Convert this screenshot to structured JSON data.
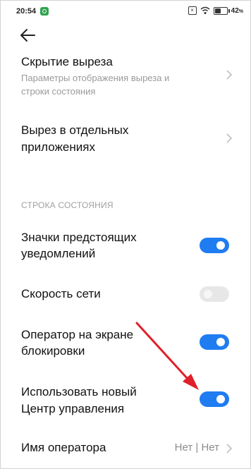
{
  "status_bar": {
    "time": "20:54",
    "battery_pct": "42",
    "percent_sign": "%"
  },
  "back_icon": "arrow-left-icon",
  "items": {
    "cutout_hide": {
      "title": "Скрытие выреза",
      "subtitle_line1": "Параметры отображения выреза и",
      "subtitle_line2": "строки состояния"
    },
    "cutout_apps": {
      "title_line1": "Вырез в отдельных",
      "title_line2": "приложениях"
    }
  },
  "section_header": "СТРОКА СОСТОЯНИЯ",
  "toggles": {
    "upcoming_notifications": {
      "label_line1": "Значки предстоящих",
      "label_line2": "уведомлений",
      "on": true
    },
    "network_speed": {
      "label": "Скорость сети",
      "on": false
    },
    "operator_lockscreen": {
      "label_line1": "Оператор на экране",
      "label_line2": "блокировки",
      "on": true
    },
    "new_control_center": {
      "label_line1": "Использовать новый",
      "label_line2": "Центр управления",
      "on": true
    }
  },
  "operator_name": {
    "label": "Имя оператора",
    "value": "Нет | Нет"
  },
  "colors": {
    "toggle_on": "#1f7cf1",
    "toggle_off": "#e7e7e7",
    "annotation_arrow": "#e0202a"
  }
}
